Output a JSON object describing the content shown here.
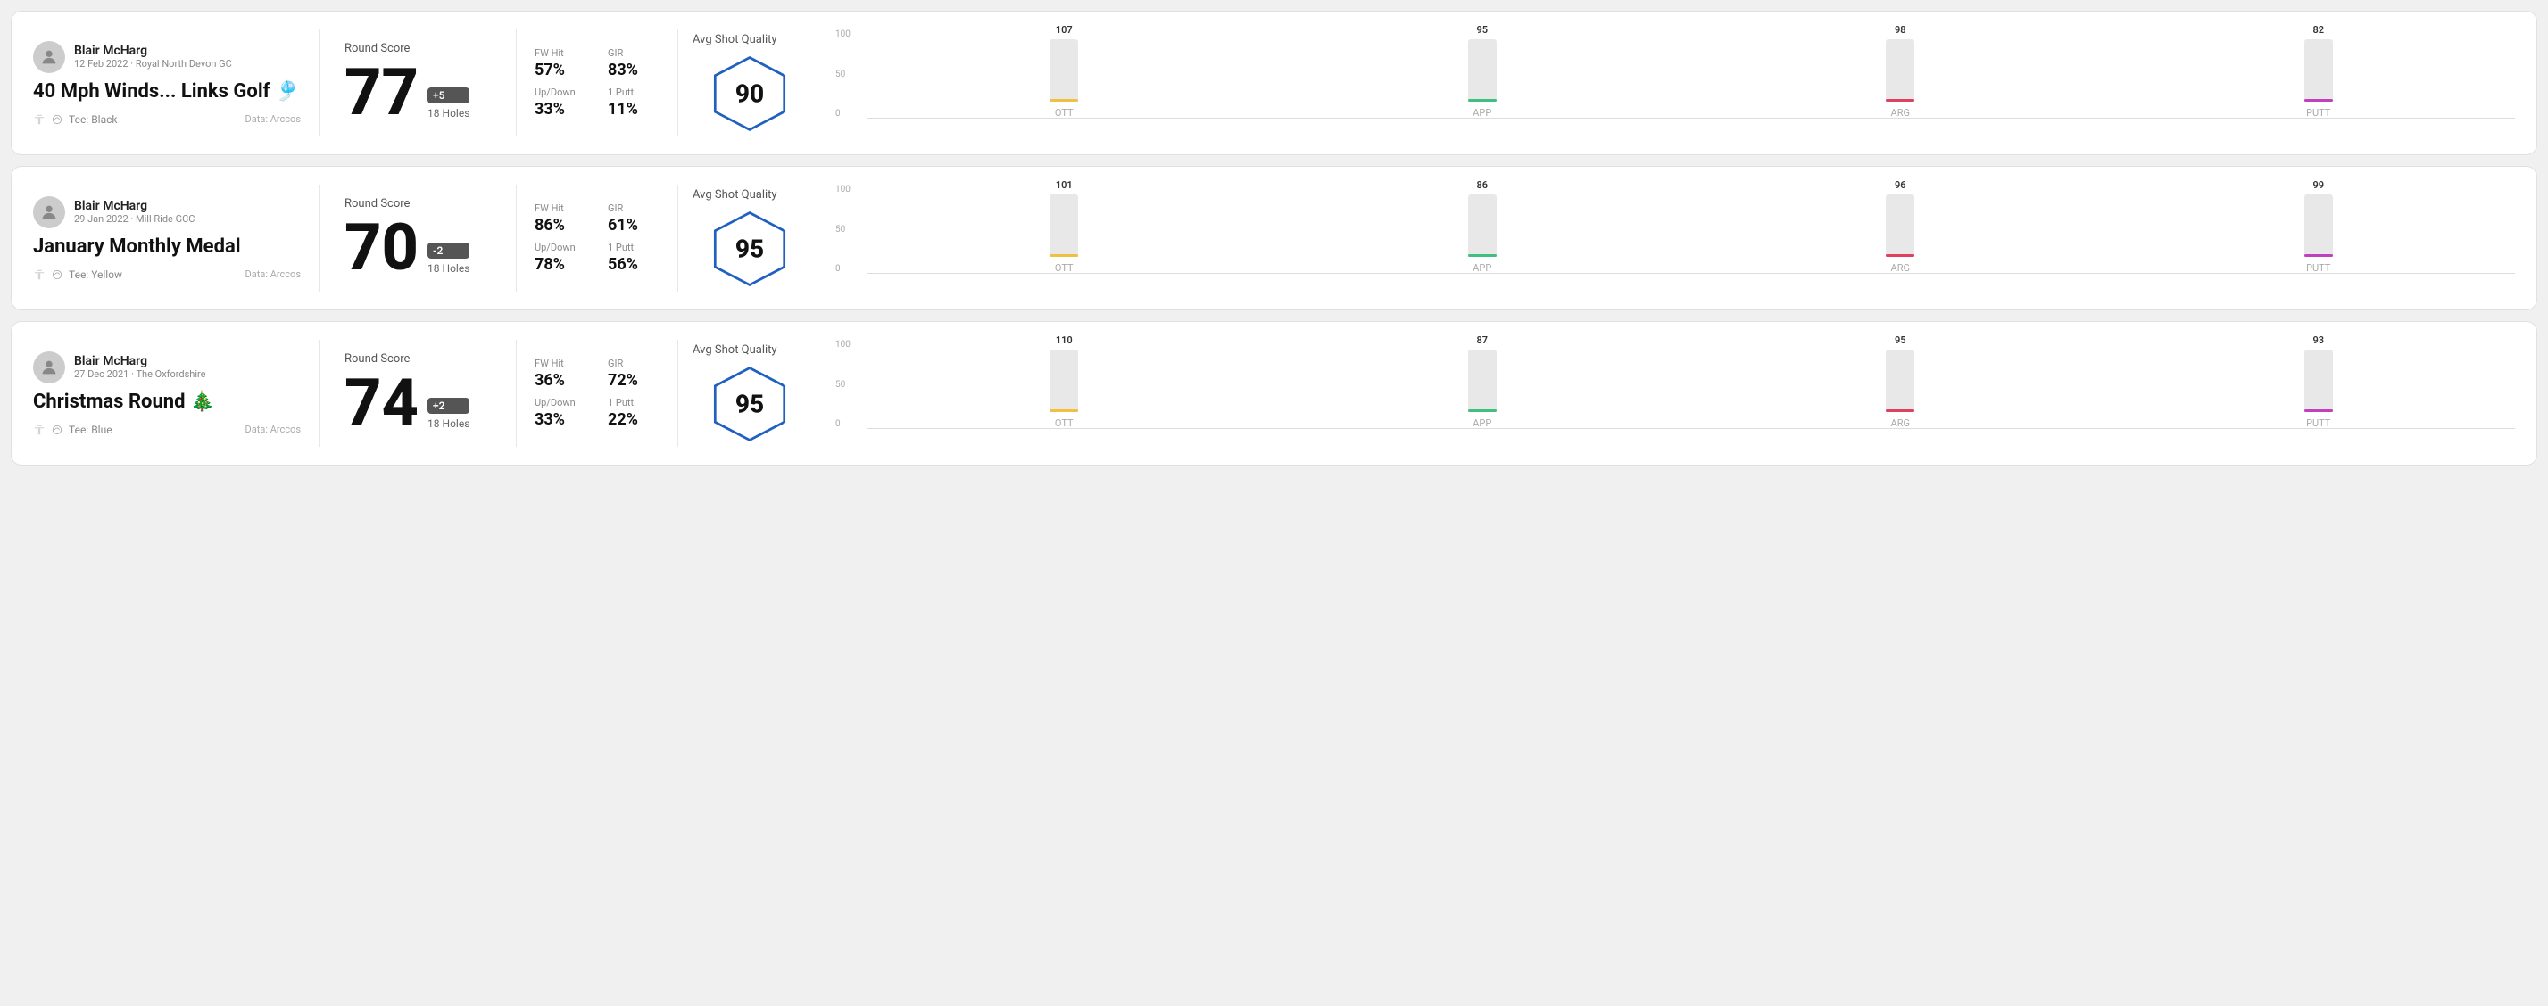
{
  "cards": [
    {
      "id": "card1",
      "user": {
        "name": "Blair McHarg",
        "date": "12 Feb 2022",
        "club": "Royal North Devon GC"
      },
      "title": "40 Mph Winds... Links Golf 🎐",
      "tee": "Black",
      "dataSource": "Data: Arccos",
      "score": {
        "value": "77",
        "badge": "+5",
        "holes": "18 Holes"
      },
      "stats": {
        "fwHitLabel": "FW Hit",
        "fwHitValue": "57%",
        "girLabel": "GIR",
        "girValue": "83%",
        "upDownLabel": "Up/Down",
        "upDownValue": "33%",
        "onePuttLabel": "1 Putt",
        "onePuttValue": "11%"
      },
      "quality": {
        "label": "Avg Shot Quality",
        "score": "90"
      },
      "chart": {
        "bars": [
          {
            "label": "OTT",
            "value": 107,
            "color": "#f0c040"
          },
          {
            "label": "APP",
            "value": 95,
            "color": "#40c080"
          },
          {
            "label": "ARG",
            "value": 98,
            "color": "#e04060"
          },
          {
            "label": "PUTT",
            "value": 82,
            "color": "#c040c0"
          }
        ]
      }
    },
    {
      "id": "card2",
      "user": {
        "name": "Blair McHarg",
        "date": "29 Jan 2022",
        "club": "Mill Ride GCC"
      },
      "title": "January Monthly Medal",
      "tee": "Yellow",
      "dataSource": "Data: Arccos",
      "score": {
        "value": "70",
        "badge": "-2",
        "holes": "18 Holes"
      },
      "stats": {
        "fwHitLabel": "FW Hit",
        "fwHitValue": "86%",
        "girLabel": "GIR",
        "girValue": "61%",
        "upDownLabel": "Up/Down",
        "upDownValue": "78%",
        "onePuttLabel": "1 Putt",
        "onePuttValue": "56%"
      },
      "quality": {
        "label": "Avg Shot Quality",
        "score": "95"
      },
      "chart": {
        "bars": [
          {
            "label": "OTT",
            "value": 101,
            "color": "#f0c040"
          },
          {
            "label": "APP",
            "value": 86,
            "color": "#40c080"
          },
          {
            "label": "ARG",
            "value": 96,
            "color": "#e04060"
          },
          {
            "label": "PUTT",
            "value": 99,
            "color": "#c040c0"
          }
        ]
      }
    },
    {
      "id": "card3",
      "user": {
        "name": "Blair McHarg",
        "date": "27 Dec 2021",
        "club": "The Oxfordshire"
      },
      "title": "Christmas Round 🎄",
      "tee": "Blue",
      "dataSource": "Data: Arccos",
      "score": {
        "value": "74",
        "badge": "+2",
        "holes": "18 Holes"
      },
      "stats": {
        "fwHitLabel": "FW Hit",
        "fwHitValue": "36%",
        "girLabel": "GIR",
        "girValue": "72%",
        "upDownLabel": "Up/Down",
        "upDownValue": "33%",
        "onePuttLabel": "1 Putt",
        "onePuttValue": "22%"
      },
      "quality": {
        "label": "Avg Shot Quality",
        "score": "95"
      },
      "chart": {
        "bars": [
          {
            "label": "OTT",
            "value": 110,
            "color": "#f0c040"
          },
          {
            "label": "APP",
            "value": 87,
            "color": "#40c080"
          },
          {
            "label": "ARG",
            "value": 95,
            "color": "#e04060"
          },
          {
            "label": "PUTT",
            "value": 93,
            "color": "#c040c0"
          }
        ]
      }
    }
  ]
}
